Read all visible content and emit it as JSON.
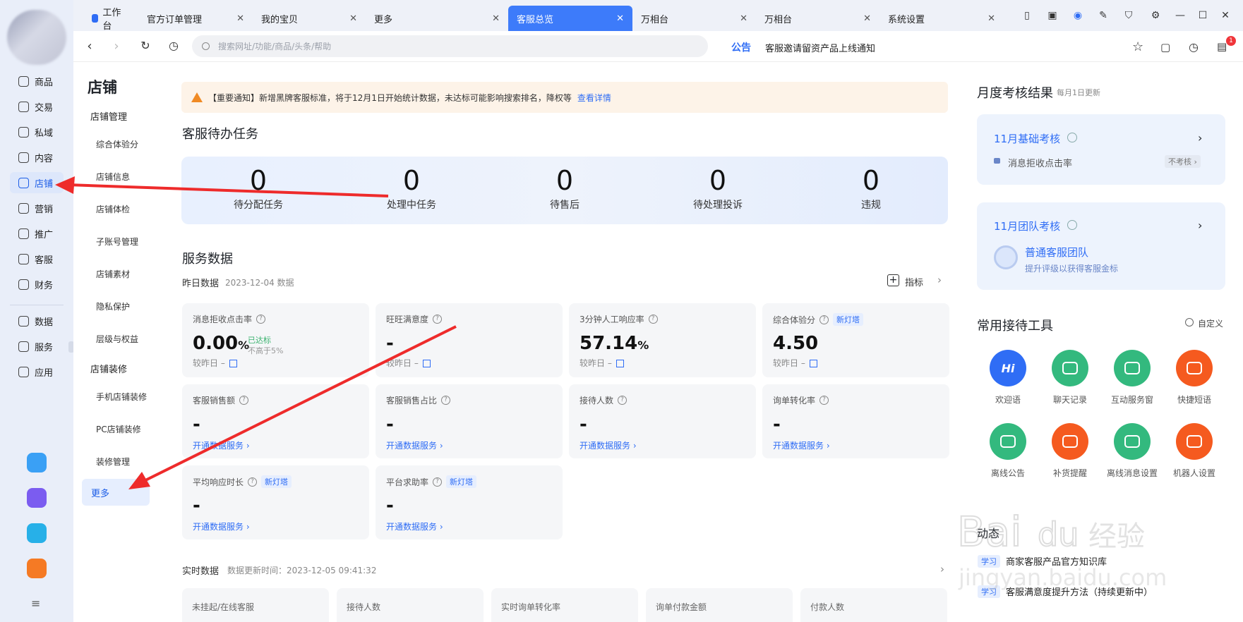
{
  "tabs": [
    {
      "label": "工作台",
      "close": ""
    },
    {
      "label": "官方订单管理",
      "close": "✕"
    },
    {
      "label": "我的宝贝",
      "close": "✕"
    },
    {
      "label": "更多",
      "close": "✕"
    },
    {
      "label": "客服总览",
      "close": "✕"
    },
    {
      "label": "万相台",
      "close": "✕"
    },
    {
      "label": "万相台",
      "close": "✕"
    },
    {
      "label": "系统设置",
      "close": "✕"
    }
  ],
  "rail": {
    "items": [
      {
        "label": "商品"
      },
      {
        "label": "交易"
      },
      {
        "label": "私域"
      },
      {
        "label": "内容"
      },
      {
        "label": "店铺"
      },
      {
        "label": "营销"
      },
      {
        "label": "推广"
      },
      {
        "label": "客服"
      },
      {
        "label": "财务"
      },
      {
        "label": "数据"
      },
      {
        "label": "服务"
      },
      {
        "label": "应用"
      }
    ],
    "menu_glyph": "≡"
  },
  "address": {
    "placeholder": "搜索网址/功能/商品/头条/帮助",
    "announce_tag": "公告",
    "announce_text": "客服邀请留资产品上线通知",
    "badge": "1"
  },
  "subnav": {
    "title": "店铺",
    "group1": "店铺管理",
    "items1": [
      "综合体验分",
      "店铺信息",
      "店铺体检",
      "子账号管理",
      "店铺素材",
      "隐私保护",
      "层级与权益"
    ],
    "group2": "店铺装修",
    "items2": [
      "手机店铺装修",
      "PC店铺装修",
      "装修管理"
    ],
    "active": "更多"
  },
  "notice": {
    "text": "【重要通知】新增黑牌客服标准，将于12月1日开始统计数据，未达标可能影响搜索排名，降权等",
    "link": "查看详情"
  },
  "todo": {
    "title": "客服待办任务",
    "items": [
      {
        "num": "0",
        "label": "待分配任务"
      },
      {
        "num": "0",
        "label": "处理中任务"
      },
      {
        "num": "0",
        "label": "待售后"
      },
      {
        "num": "0",
        "label": "待处理投诉"
      },
      {
        "num": "0",
        "label": "违规"
      }
    ]
  },
  "service": {
    "title": "服务数据",
    "sub_label": "昨日数据",
    "sub_date": "2023-12-04 数据",
    "metric_btn": "指标",
    "compare": "较昨日 –",
    "link": "开通数据服务 ›",
    "cards": [
      {
        "title": "消息拒收点击率",
        "value": "0.00",
        "unit": "%",
        "status": "已达标",
        "status_note": "不高于5%"
      },
      {
        "title": "旺旺满意度",
        "value": "-"
      },
      {
        "title": "3分钟人工响应率",
        "value": "57.14",
        "unit": "%"
      },
      {
        "title": "综合体验分",
        "value": "4.50",
        "tag": "新灯塔"
      },
      {
        "title": "客服销售额",
        "value": "-"
      },
      {
        "title": "客服销售占比",
        "value": "-"
      },
      {
        "title": "接待人数",
        "value": "-"
      },
      {
        "title": "询单转化率",
        "value": "-"
      },
      {
        "title": "平均响应时长",
        "value": "-",
        "tag": "新灯塔"
      },
      {
        "title": "平台求助率",
        "value": "-",
        "tag": "新灯塔"
      }
    ]
  },
  "realtime": {
    "title": "实时数据",
    "update": "数据更新时间：2023-12-05 09:41:32",
    "cols": [
      "未挂起/在线客服",
      "接待人数",
      "实时询单转化率",
      "询单付款金额",
      "付款人数"
    ]
  },
  "right": {
    "title": "月度考核结果",
    "title_note": "每月1日更新",
    "basic": {
      "title": "11月基础考核",
      "item": "消息拒收点击率",
      "tag": "不考核 ›"
    },
    "team": {
      "title": "11月团队考核",
      "name": "普通客服团队",
      "note": "提升评级以获得客服金标"
    },
    "tools_title": "常用接待工具",
    "customize": "自定义",
    "tools": [
      {
        "label": "欢迎语",
        "glyph": "Hi",
        "color": "#2f6df5"
      },
      {
        "label": "聊天记录",
        "color": "#33b97e"
      },
      {
        "label": "互动服务窗",
        "color": "#33b97e"
      },
      {
        "label": "快捷短语",
        "color": "#f55a1f"
      },
      {
        "label": "离线公告",
        "color": "#33b97e"
      },
      {
        "label": "补货提醒",
        "color": "#f55a1f"
      },
      {
        "label": "离线消息设置",
        "color": "#33b97e"
      },
      {
        "label": "机器人设置",
        "color": "#f55a1f"
      }
    ],
    "feed_title": "动态",
    "feed": [
      {
        "tag": "学习",
        "text": "商家客服产品官方知识库"
      },
      {
        "tag": "学习",
        "text": "客服满意度提升方法（持续更新中）"
      }
    ]
  },
  "watermark": {
    "text": "Bai du 经验",
    "sub": "jingyan.baidu.com"
  }
}
